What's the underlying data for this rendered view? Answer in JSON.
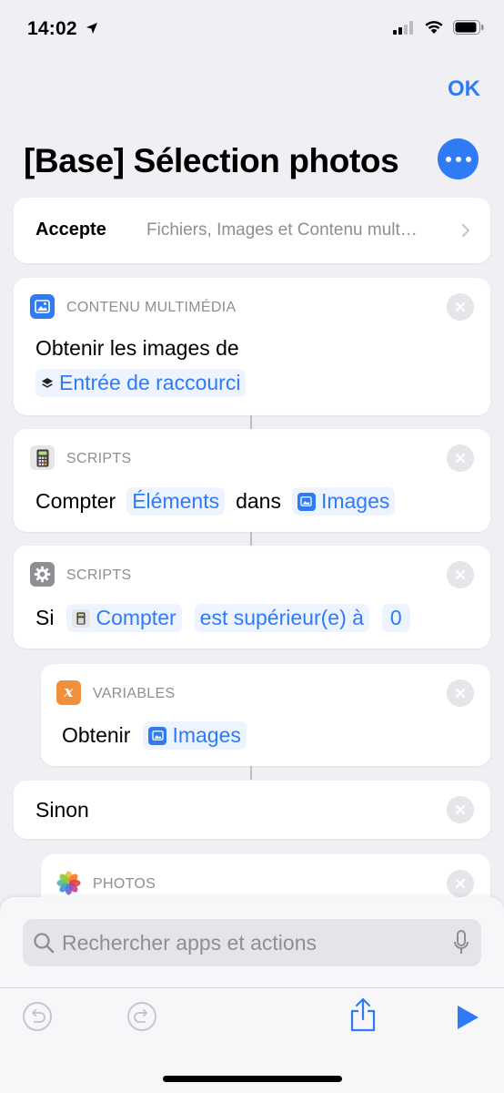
{
  "status_bar": {
    "time": "14:02",
    "icons": [
      "location-arrow-icon",
      "cellular-signal-icon",
      "wifi-icon",
      "battery-icon"
    ]
  },
  "header": {
    "ok_label": "OK",
    "title": "[Base] Sélection photos",
    "more_icon": "ellipsis-icon"
  },
  "accept_row": {
    "label": "Accepte",
    "value": "Fichiers, Images et Contenu mult…"
  },
  "actions": [
    {
      "category": "CONTENU MULTIMÉDIA",
      "text": "Obtenir les images de",
      "token": "Entrée de raccourci"
    },
    {
      "category": "SCRIPTS",
      "verb": "Compter",
      "token1": "Éléments",
      "connector": "dans",
      "token2": "Images"
    },
    {
      "category": "SCRIPTS",
      "if": "Si",
      "token1": "Compter",
      "token2": "est supérieur(e) à",
      "token3": "0"
    },
    {
      "category": "VARIABLES",
      "verb": "Obtenir",
      "token": "Images"
    },
    {
      "text": "Sinon"
    },
    {
      "category": "PHOTOS"
    }
  ],
  "search": {
    "placeholder": "Rechercher apps et actions"
  },
  "colors": {
    "accent": "#2f7bf5",
    "background": "#efeff4",
    "variables_orange": "#f0903a"
  }
}
